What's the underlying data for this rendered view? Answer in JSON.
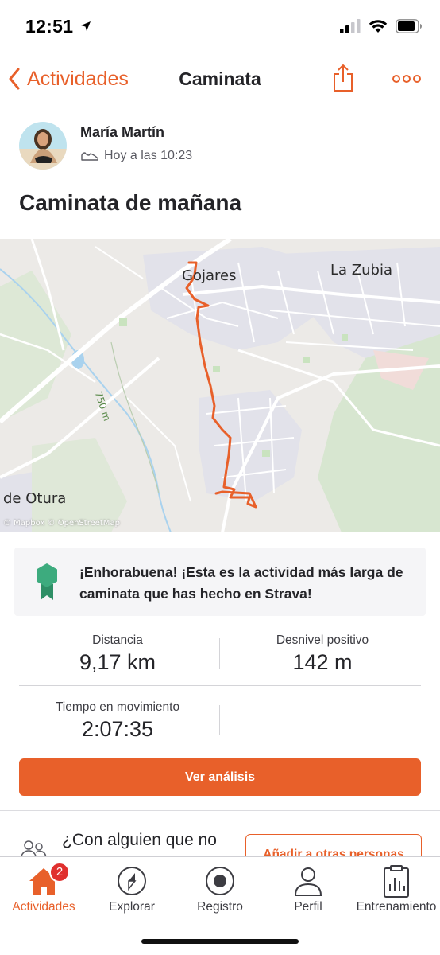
{
  "status": {
    "time": "12:51"
  },
  "nav": {
    "back_label": "Actividades",
    "title": "Caminata"
  },
  "athlete": {
    "name": "María Martín",
    "timestamp": "Hoy a las 10:23"
  },
  "activity": {
    "title": "Caminata de mañana"
  },
  "map": {
    "labels": {
      "town1": "Gojares",
      "town2": "La Zubia",
      "town3": "de Otura",
      "contour": "750 m"
    },
    "attribution": "© Mapbox © OpenStreetMap"
  },
  "banner": {
    "text": "¡Enhorabuena! ¡Esta es la actividad más larga de caminata que has hecho en Strava!"
  },
  "stats": {
    "distance_label": "Distancia",
    "distance_value": "9,17 km",
    "elevation_label": "Desnivel positivo",
    "elevation_value": "142 m",
    "moving_time_label": "Tiempo en movimiento",
    "moving_time_value": "2:07:35"
  },
  "analysis_button": "Ver análisis",
  "companions": {
    "question": "¿Con alguien que no",
    "add_button": "Añadir a otras personas"
  },
  "tabbar": {
    "tabs": [
      {
        "label": "Actividades",
        "badge": "2"
      },
      {
        "label": "Explorar"
      },
      {
        "label": "Registro"
      },
      {
        "label": "Perfil"
      },
      {
        "label": "Entrenamiento"
      }
    ]
  },
  "colors": {
    "accent": "#e8602a",
    "badge": "#e0302e",
    "achievement": "#3dab7e"
  }
}
